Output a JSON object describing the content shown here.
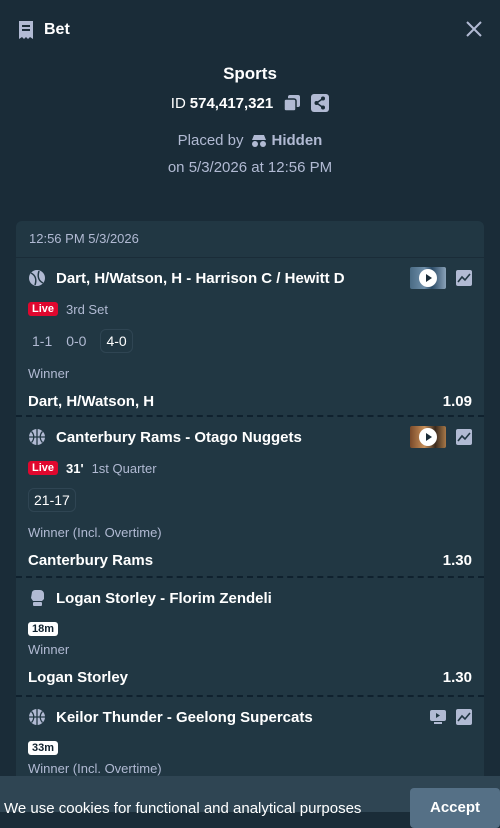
{
  "header": {
    "title": "Bet"
  },
  "summary": {
    "sport": "Sports",
    "id_label": "ID",
    "id_value": "574,417,321",
    "placed_by": "Placed by",
    "hidden_user": "Hidden",
    "placed_on": "on 5/3/2026 at 12:56 PM"
  },
  "card": {
    "timestamp": "12:56 PM 5/3/2026",
    "legs": [
      {
        "sport_icon": "tennis-icon",
        "event": "Dart, H/Watson, H - Harrison C / Hewitt D",
        "live": "Live",
        "period": "3rd Set",
        "scores": [
          "1-1",
          "0-0",
          "4-0"
        ],
        "market": "Winner",
        "selection": "Dart, H/Watson, H",
        "odds": "1.09"
      },
      {
        "sport_icon": "basketball-icon",
        "event": "Canterbury Rams - Otago Nuggets",
        "live": "Live",
        "minute": "31'",
        "period": "1st Quarter",
        "scores": [
          "21-17"
        ],
        "market": "Winner (Incl. Overtime)",
        "selection": "Canterbury Rams",
        "odds": "1.30"
      },
      {
        "sport_icon": "boxing-glove-icon",
        "event": "Logan Storley - Florim Zendeli",
        "time": "18m",
        "market": "Winner",
        "selection": "Logan Storley",
        "odds": "1.30"
      },
      {
        "sport_icon": "basketball-icon",
        "event": "Keilor Thunder - Geelong Supercats",
        "time": "33m",
        "market": "Winner (Incl. Overtime)"
      }
    ]
  },
  "cookie": {
    "text": "We use cookies for functional and analytical purposes",
    "accept": "Accept"
  }
}
